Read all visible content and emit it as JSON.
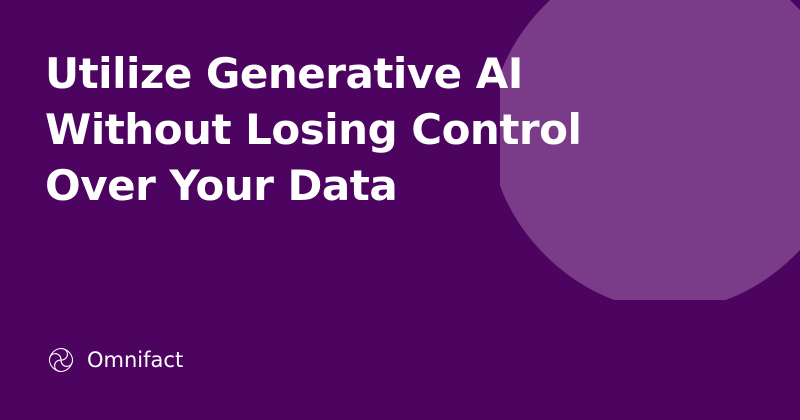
{
  "headline": {
    "line1": "Utilize Generative AI",
    "line2": "Without Losing Control",
    "line3": "Over Your Data"
  },
  "brand": {
    "name": "Omnifact",
    "logo_icon": "omnifact-knot-icon"
  },
  "colors": {
    "background": "#4d0460",
    "decoration": "#7a3c89",
    "text": "#ffffff"
  }
}
